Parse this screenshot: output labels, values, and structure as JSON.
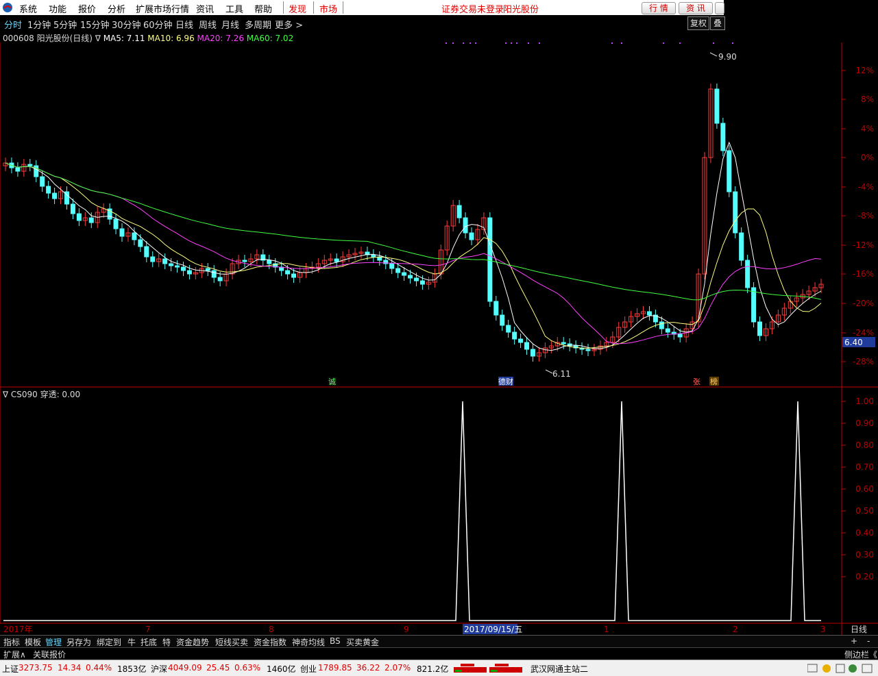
{
  "menu": {
    "items": [
      "系统",
      "功能",
      "报价",
      "分析",
      "扩展市场行情",
      "资讯",
      "工具",
      "帮助"
    ],
    "discover": "发现",
    "market": "市场",
    "login_status": "证券交易未登录",
    "stock_name_top": "阳光股份",
    "btn_quote": "行 情",
    "btn_info": "资 讯"
  },
  "periods": [
    "分时",
    "1分钟",
    "5分钟",
    "15分钟",
    "30分钟",
    "60分钟",
    "日线",
    "周线",
    "月线",
    "多周期",
    "更多 >"
  ],
  "right_buttons": [
    "复权",
    "叠加"
  ],
  "main_chart": {
    "header_code": "000608 阳光股份(日线)",
    "ma5_label": "MA5: 7.11",
    "ma10_label": "MA10: 6.96",
    "ma20_label": "MA20: 7.26",
    "ma60_label": "MA60: 7.02",
    "y_ticks": [
      "12%",
      "8%",
      "4%",
      "0%",
      "-4%",
      "-8%",
      "-12%",
      "-16%",
      "-20%",
      "-24%",
      "-28%"
    ],
    "current_price": "6.40",
    "high_label": "9.90",
    "low_label": "6.11",
    "markers": [
      "诚",
      "德财",
      "张",
      "榜"
    ]
  },
  "sub_chart": {
    "header": "∇ CS090",
    "value_label": "穿透: 0.00",
    "y_ticks": [
      "1.00",
      "0.90",
      "0.80",
      "0.70",
      "0.60",
      "0.50",
      "0.40",
      "0.30",
      "0.20"
    ]
  },
  "x_axis": {
    "labels": [
      "2017年",
      "7",
      "8",
      "9",
      "2017/09/15/五",
      "2",
      "1",
      "2",
      "3"
    ],
    "period_label": "日线"
  },
  "tabs": [
    "指标",
    "模板",
    "管理",
    "另存为",
    "绑定到",
    "牛",
    "托底",
    "特",
    "资金趋势",
    "短线买卖",
    "资金指数",
    "神奇均线",
    "BS",
    "买卖黄金"
  ],
  "tab_plus": "+",
  "tab_minus": "-",
  "bar2": {
    "left1": "扩展∧",
    "left2": "关联报价",
    "right": "侧边栏《"
  },
  "status": {
    "sh_name": "上证",
    "sh_val": "3273.75",
    "sh_chg": "14.34",
    "sh_pct": "0.44%",
    "sh_amt": "1853亿",
    "sz_name": "沪深",
    "sz_val": "4049.09",
    "sz_chg": "25.45",
    "sz_pct": "0.63%",
    "sz_amt": "1460亿",
    "cy_name": "创业",
    "cy_val": "1789.85",
    "cy_chg": "36.22",
    "cy_pct": "2.07%",
    "cy_amt": "821.2亿",
    "server": "武汉网通主站二"
  },
  "colors": {
    "up": "#ff3c3c",
    "down": "#54ffff",
    "ma5": "#ffffff",
    "ma10": "#ffff80",
    "ma20": "#ff40ff",
    "ma60": "#40ff40",
    "axis": "#c00000"
  }
}
